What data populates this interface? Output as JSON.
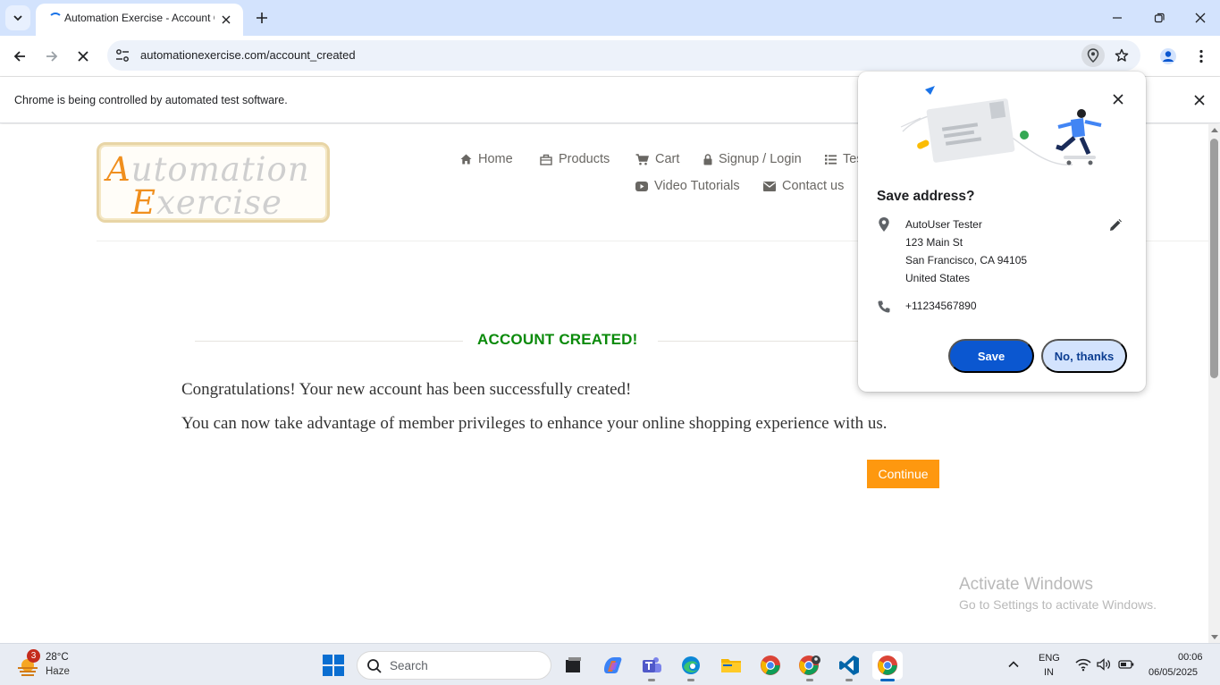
{
  "browser": {
    "tab_title": "Automation Exercise - Account Created",
    "url": "automationexercise.com/account_created",
    "infobar_message": "Chrome is being controlled by automated test software."
  },
  "site": {
    "logo_line1_cap": "A",
    "logo_line1_rest": "utomation",
    "logo_line2_cap": "E",
    "logo_line2_rest": "xercise",
    "nav": {
      "home": "Home",
      "products": "Products",
      "cart": "Cart",
      "signup": "Signup / Login",
      "test_cases": "Tes",
      "video": "Video Tutorials",
      "contact": "Contact us"
    },
    "heading": "ACCOUNT CREATED!",
    "paragraph1": "Congratulations! Your new account has been successfully created!",
    "paragraph2": "You can now take advantage of member privileges to enhance your online shopping experience with us.",
    "continue_label": "Continue"
  },
  "watermark": {
    "line1": "Activate Windows",
    "line2": "Go to Settings to activate Windows."
  },
  "save_address": {
    "heading": "Save address?",
    "name": "AutoUser Tester",
    "street": "123 Main St",
    "city": "San Francisco, CA 94105",
    "country": "United States",
    "phone": "+11234567890",
    "save_label": "Save",
    "no_thanks_label": "No, thanks"
  },
  "taskbar": {
    "weather_badge": "3",
    "temperature": "28°C",
    "condition": "Haze",
    "search_placeholder": "Search",
    "lang_line1": "ENG",
    "lang_line2": "IN",
    "time": "00:06",
    "date": "06/05/2025"
  },
  "colors": {
    "heading_green": "#0a8a0a",
    "continue_orange": "#fe980f",
    "save_blue": "#0b57d0",
    "tabstrip": "#d3e3fd"
  }
}
